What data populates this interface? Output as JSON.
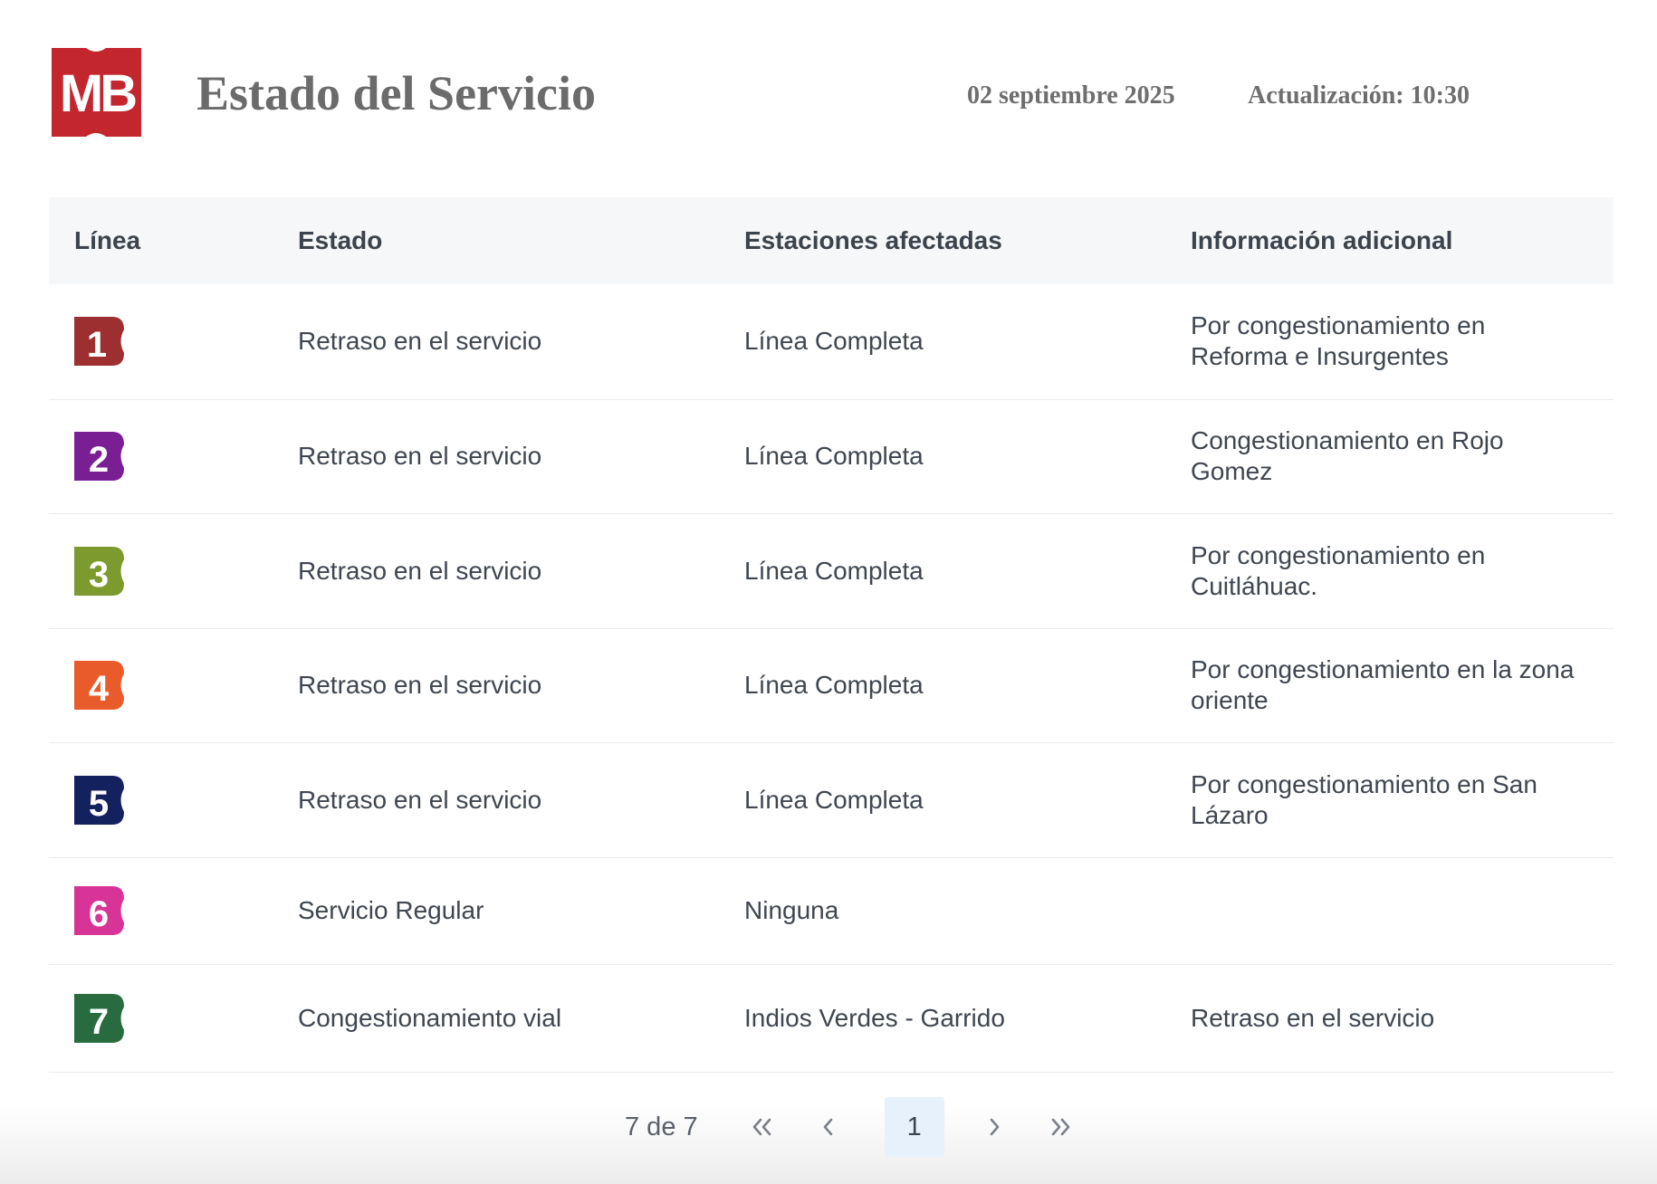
{
  "header": {
    "title": "Estado del Servicio",
    "date": "02 septiembre 2025",
    "updated": "Actualización: 10:30",
    "logo_text": "MB",
    "logo_color": "#c4262e"
  },
  "table": {
    "columns": [
      "Línea",
      "Estado",
      "Estaciones afectadas",
      "Información adicional"
    ],
    "rows": [
      {
        "line": "1",
        "color": "#9d2f30",
        "estado": "Retraso en el servicio",
        "estaciones": "Línea Completa",
        "info": "Por congestionamiento en Reforma e Insurgentes"
      },
      {
        "line": "2",
        "color": "#7a1e93",
        "estado": "Retraso en el servicio",
        "estaciones": "Línea Completa",
        "info": "Congestionamiento en Rojo Gomez"
      },
      {
        "line": "3",
        "color": "#7d9a2e",
        "estado": "Retraso en el servicio",
        "estaciones": "Línea Completa",
        "info": "Por congestionamiento en Cuitláhuac."
      },
      {
        "line": "4",
        "color": "#ea5b2c",
        "estado": "Retraso en el servicio",
        "estaciones": "Línea Completa",
        "info": "Por congestionamiento en la zona oriente"
      },
      {
        "line": "5",
        "color": "#13215e",
        "estado": "Retraso en el servicio",
        "estaciones": "Línea Completa",
        "info": "Por congestionamiento en San Lázaro"
      },
      {
        "line": "6",
        "color": "#d83497",
        "estado": "Servicio Regular",
        "estaciones": "Ninguna",
        "info": ""
      },
      {
        "line": "7",
        "color": "#276b3e",
        "estado": "Congestionamiento vial",
        "estaciones": "Indios Verdes - Garrido",
        "info": "Retraso en el servicio"
      }
    ]
  },
  "pagination": {
    "info": "7 de 7",
    "current_page": "1",
    "first_icon": "double-chevron-left-icon",
    "prev_icon": "chevron-left-icon",
    "next_icon": "chevron-right-icon",
    "last_icon": "double-chevron-right-icon"
  }
}
